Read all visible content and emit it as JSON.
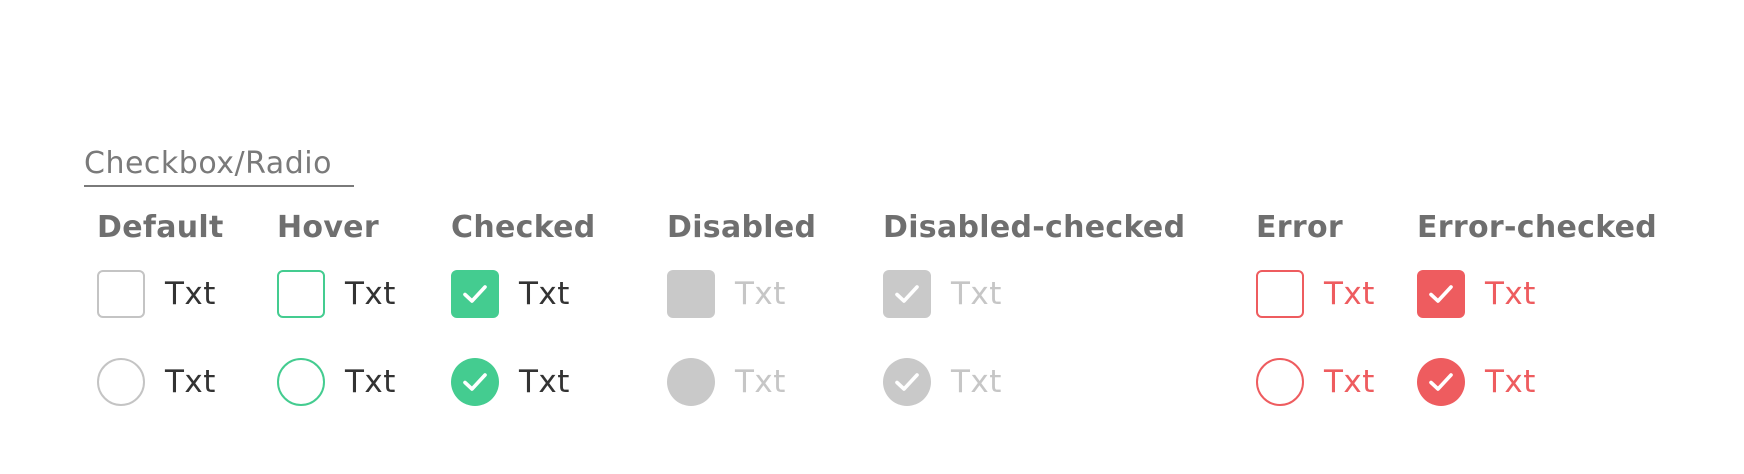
{
  "section": {
    "title": "Checkbox/Radio"
  },
  "colors": {
    "accent": "#44cc90",
    "error": "#ee5c5f",
    "disabled": "#c9c9c9",
    "border_default": "#c4c4c4",
    "text": "#333333",
    "text_disabled": "#c6c6c6",
    "header_text": "#6f6f6f"
  },
  "columns": [
    {
      "state": "default",
      "header": "Default",
      "checkbox_label": "Txt",
      "radio_label": "Txt",
      "checked": false
    },
    {
      "state": "hover",
      "header": "Hover",
      "checkbox_label": "Txt",
      "radio_label": "Txt",
      "checked": false
    },
    {
      "state": "checked",
      "header": "Checked",
      "checkbox_label": "Txt",
      "radio_label": "Txt",
      "checked": true,
      "icon": "check-icon"
    },
    {
      "state": "disabled",
      "header": "Disabled",
      "checkbox_label": "Txt",
      "radio_label": "Txt",
      "checked": false
    },
    {
      "state": "disabled-checked",
      "header": "Disabled-checked",
      "checkbox_label": "Txt",
      "radio_label": "Txt",
      "checked": true,
      "icon": "check-icon"
    },
    {
      "state": "error",
      "header": "Error",
      "checkbox_label": "Txt",
      "radio_label": "Txt",
      "checked": false
    },
    {
      "state": "error-checked",
      "header": "Error-checked",
      "checkbox_label": "Txt",
      "radio_label": "Txt",
      "checked": true,
      "icon": "check-icon"
    }
  ]
}
